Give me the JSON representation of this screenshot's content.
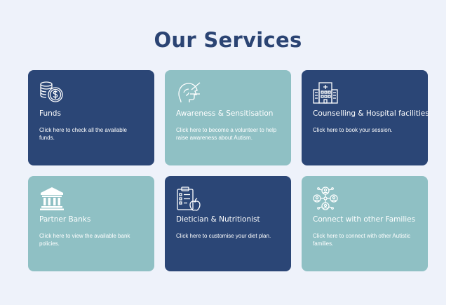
{
  "page": {
    "title": "Our Services"
  },
  "colors": {
    "dark_card": "#2b4676",
    "light_card": "#8fc0c4",
    "title": "#2b4473",
    "background": "#eef2fa"
  },
  "services": [
    {
      "title": "Funds",
      "description": "Click here to check all the available funds.",
      "icon": "coins-dollar-icon"
    },
    {
      "title": "Awareness & Sensitisation",
      "description": "Click here to become a volunteer to help raise awareness about Autism.",
      "icon": "head-awareness-icon"
    },
    {
      "title": "Counselling & Hospital facilities",
      "description": "Click here to book your session.",
      "icon": "hospital-icon"
    },
    {
      "title": "Partner Banks",
      "description": "Click here to view the available bank policies.",
      "icon": "bank-icon"
    },
    {
      "title": "Dietician & Nutritionist",
      "description": "Click here to customise your diet plan.",
      "icon": "diet-clipboard-icon"
    },
    {
      "title": "Connect with other Families",
      "description": "Click here to connect with other Autistic families.",
      "icon": "network-people-icon"
    }
  ]
}
